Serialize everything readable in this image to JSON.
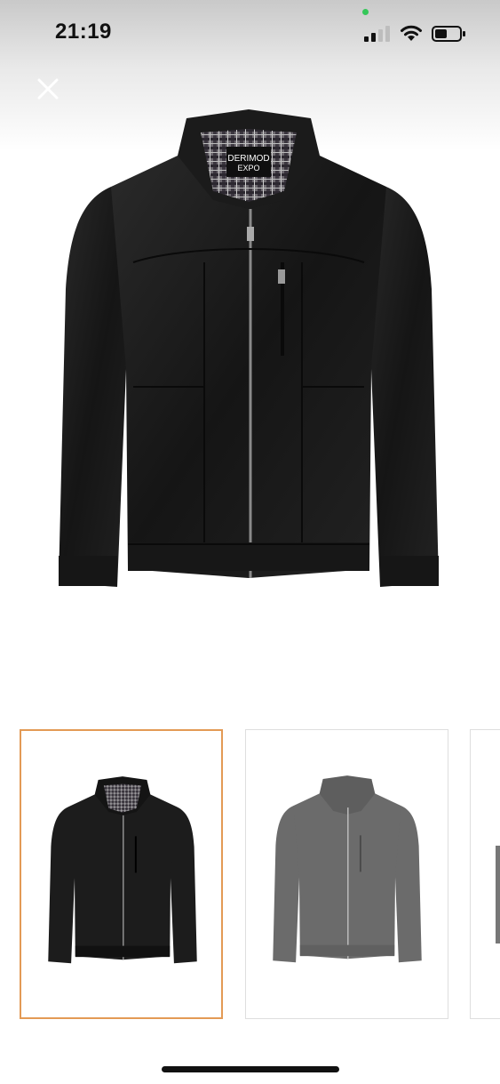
{
  "status_bar": {
    "time": "21:19",
    "signal_icon": "cellular-signal-icon",
    "wifi_icon": "wifi-icon",
    "battery_icon": "battery-icon"
  },
  "header": {
    "close_icon": "close-icon"
  },
  "product_image": {
    "brand_label_line1": "DERIMOD",
    "brand_label_line2": "EXPO",
    "jacket_color": "#1c1c1c"
  },
  "thumbnails": [
    {
      "variant": "black",
      "selected": true
    },
    {
      "variant": "grey",
      "selected": false
    },
    {
      "variant": "partial",
      "selected": false
    }
  ],
  "colors": {
    "selected_border": "#e39a55",
    "thumb_border": "#dedede",
    "status_dot": "#35c759"
  }
}
